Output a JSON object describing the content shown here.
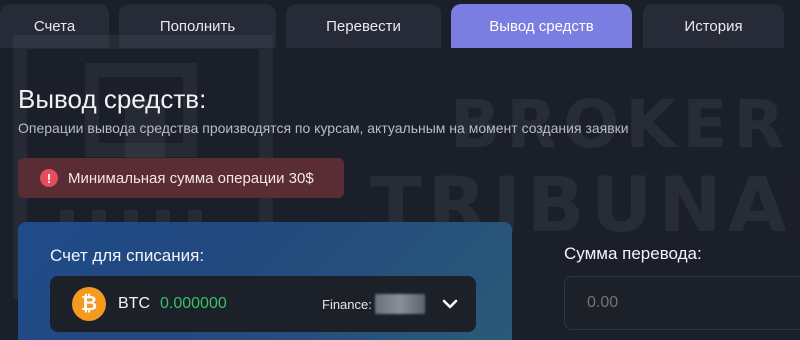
{
  "tabs": [
    {
      "label": "Счета",
      "active": false
    },
    {
      "label": "Пополнить",
      "active": false
    },
    {
      "label": "Перевести",
      "active": false
    },
    {
      "label": "Вывод средств",
      "active": true
    },
    {
      "label": "История",
      "active": false
    }
  ],
  "watermark": {
    "line1": "BROKER",
    "line2": "TRIBUNAL"
  },
  "page": {
    "title": "Вывод средств:",
    "subtitle": "Операции вывода средства производятся по курсам, актуальным на момент создания заявки"
  },
  "alert": {
    "icon": "!",
    "text": "Минимальная сумма операции 30$"
  },
  "debit": {
    "label": "Счет для списания:",
    "currency_icon": "₿",
    "currency": "BTC",
    "balance": "0.000000",
    "finance_label": "Finance:"
  },
  "transfer": {
    "label": "Сумма перевода:",
    "placeholder": "0.00"
  },
  "colors": {
    "accent": "#7a7ee0",
    "background": "#1b1f2a",
    "tab": "#262b37",
    "alert_bg": "#5a2c33",
    "alert_icon": "#e24e5a",
    "btc": "#f49b1f",
    "balance": "#39c06a"
  }
}
